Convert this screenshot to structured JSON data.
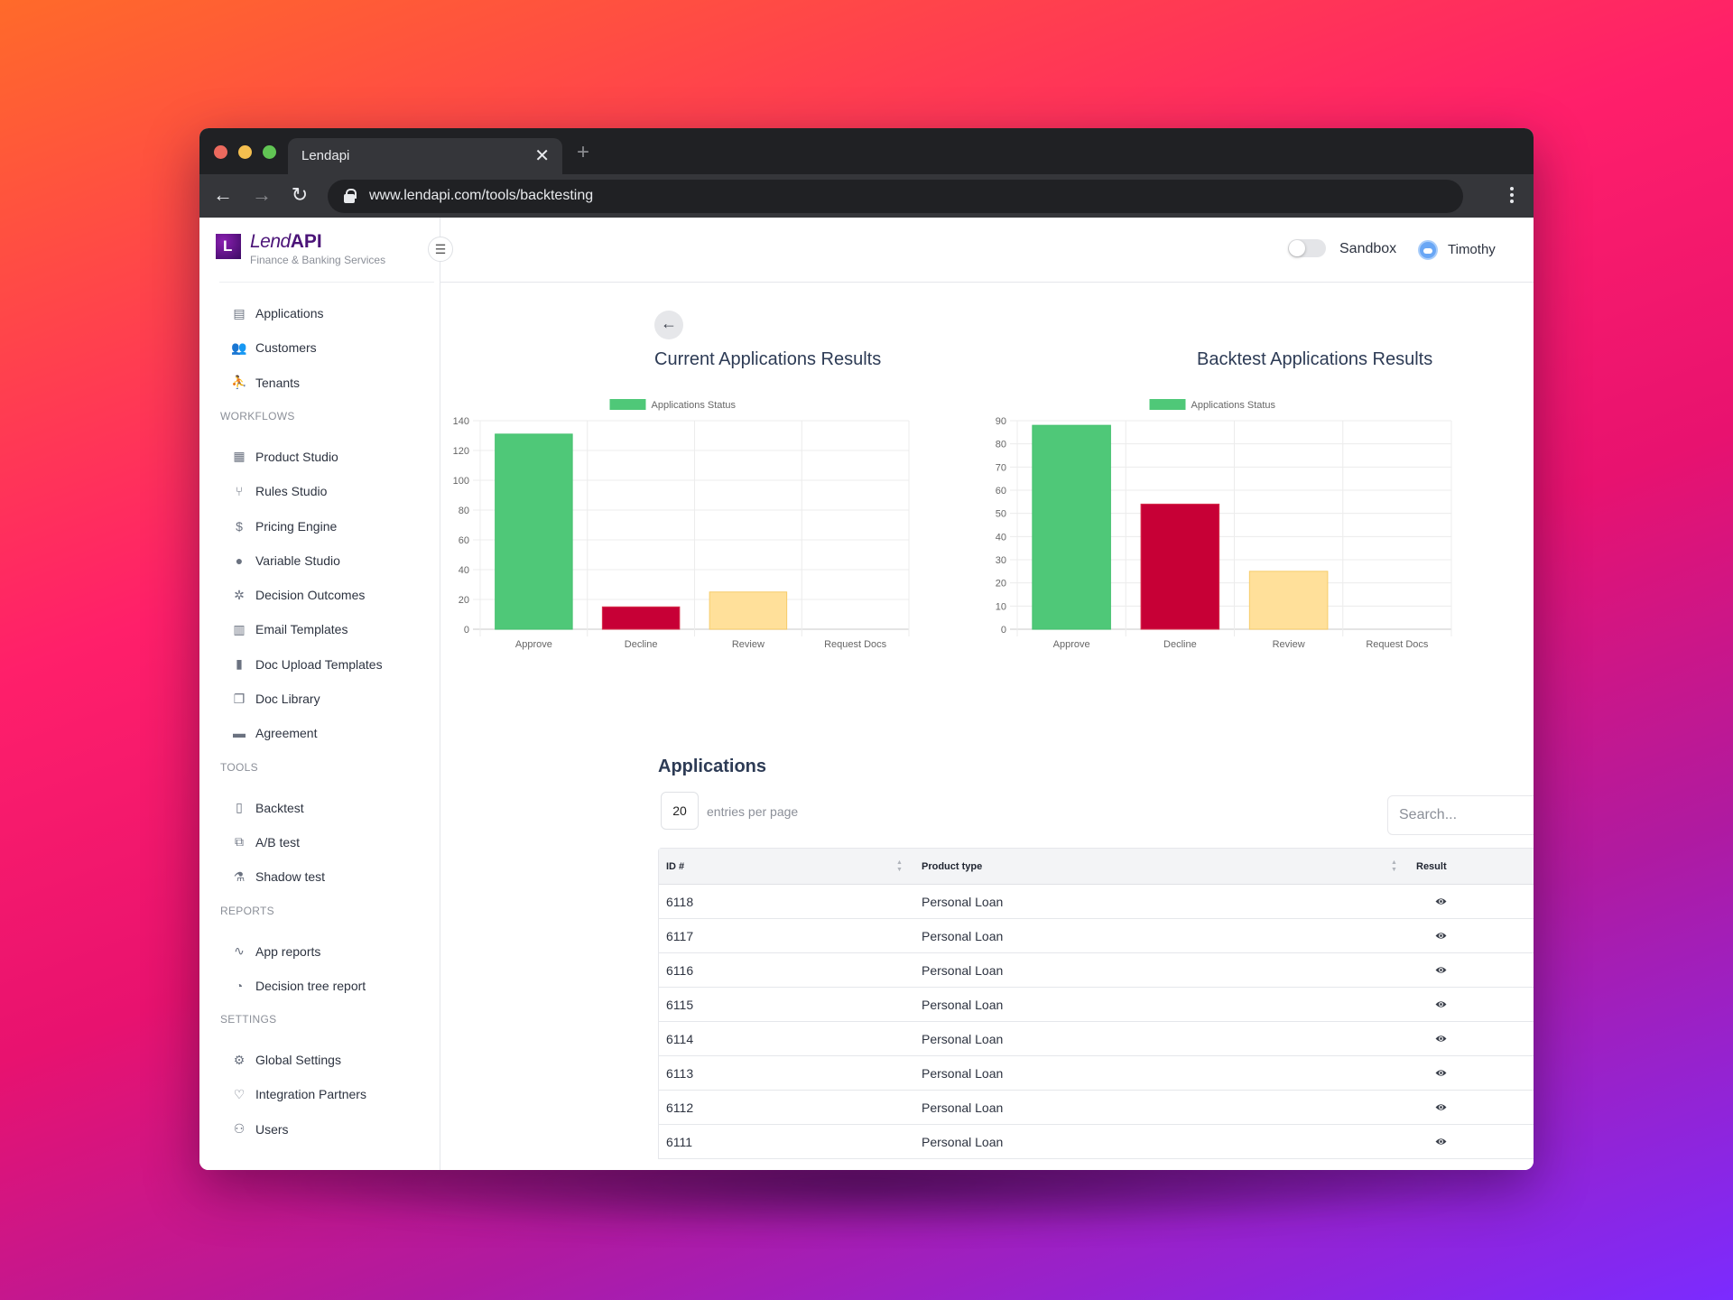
{
  "browser": {
    "tab_title": "Lendapi",
    "url": "www.lendapi.com/tools/backtesting"
  },
  "brand": {
    "logo_letter": "L",
    "name_light": "Lend",
    "name_bold": "API",
    "subtitle": "Finance & Banking Services"
  },
  "sidebar": {
    "top_items": [
      {
        "label": "Applications",
        "icon": "id-card-icon"
      },
      {
        "label": "Customers",
        "icon": "users-group-icon"
      },
      {
        "label": "Tenants",
        "icon": "user-star-icon"
      }
    ],
    "sections": [
      {
        "title": "WORKFLOWS",
        "items": [
          {
            "label": "Product Studio",
            "icon": "table-layout-icon"
          },
          {
            "label": "Rules Studio",
            "icon": "git-branch-icon"
          },
          {
            "label": "Pricing Engine",
            "icon": "dollar-cycle-icon"
          },
          {
            "label": "Variable Studio",
            "icon": "shapes-icon"
          },
          {
            "label": "Decision Outcomes",
            "icon": "network-icon"
          },
          {
            "label": "Email Templates",
            "icon": "email-templates-icon"
          },
          {
            "label": "Doc Upload Templates",
            "icon": "documents-icon"
          },
          {
            "label": "Doc Library",
            "icon": "copy-icon"
          },
          {
            "label": "Agreement",
            "icon": "agreement-icon"
          }
        ]
      },
      {
        "title": "TOOLS",
        "items": [
          {
            "label": "Backtest",
            "icon": "test-tube-icon"
          },
          {
            "label": "A/B test",
            "icon": "ab-monitor-icon"
          },
          {
            "label": "Shadow test",
            "icon": "flask-icon"
          }
        ]
      },
      {
        "title": "REPORTS",
        "items": [
          {
            "label": "App reports",
            "icon": "activity-icon"
          },
          {
            "label": "Decision tree report",
            "icon": "pie-chart-icon"
          }
        ]
      },
      {
        "title": "SETTINGS",
        "items": [
          {
            "label": "Global Settings",
            "icon": "gear-icon"
          },
          {
            "label": "Integration Partners",
            "icon": "handshake-heart-icon"
          },
          {
            "label": "Users",
            "icon": "users-icon"
          }
        ]
      }
    ]
  },
  "header": {
    "sandbox_label": "Sandbox",
    "sandbox_on": false,
    "user_name": "Timothy"
  },
  "actions": {
    "show_details": "Show Details"
  },
  "chart_data": [
    {
      "type": "bar",
      "title": "Current Applications Results",
      "legend": [
        "Applications Status"
      ],
      "legend_position": "top",
      "categories": [
        "Approve",
        "Decline",
        "Review",
        "Request Docs"
      ],
      "values": [
        131,
        15,
        25,
        0
      ],
      "colors": [
        "#4fc878",
        "#c70036",
        "#ffe09a",
        "#cccccc"
      ],
      "ylim": [
        0,
        140
      ],
      "yticks": [
        0,
        20,
        40,
        60,
        80,
        100,
        120,
        140
      ],
      "xlabel": "",
      "ylabel": "",
      "grid": true
    },
    {
      "type": "bar",
      "title": "Backtest Applications Results",
      "legend": [
        "Applications Status"
      ],
      "legend_position": "top",
      "categories": [
        "Approve",
        "Decline",
        "Review",
        "Request Docs"
      ],
      "values": [
        88,
        54,
        25,
        0
      ],
      "colors": [
        "#4fc878",
        "#c70036",
        "#ffe09a",
        "#cccccc"
      ],
      "ylim": [
        0,
        90
      ],
      "yticks": [
        0,
        10,
        20,
        30,
        40,
        50,
        60,
        70,
        80,
        90
      ],
      "xlabel": "",
      "ylabel": "",
      "grid": true
    }
  ],
  "applications": {
    "title": "Applications",
    "per_page": "20",
    "per_page_label": "entries per page",
    "search_placeholder": "Search...",
    "columns": [
      "ID #",
      "Product type",
      "Result"
    ],
    "rows": [
      {
        "id": "6118",
        "product": "Personal Loan"
      },
      {
        "id": "6117",
        "product": "Personal Loan"
      },
      {
        "id": "6116",
        "product": "Personal Loan"
      },
      {
        "id": "6115",
        "product": "Personal Loan"
      },
      {
        "id": "6114",
        "product": "Personal Loan"
      },
      {
        "id": "6113",
        "product": "Personal Loan"
      },
      {
        "id": "6112",
        "product": "Personal Loan"
      },
      {
        "id": "6111",
        "product": "Personal Loan"
      }
    ]
  }
}
